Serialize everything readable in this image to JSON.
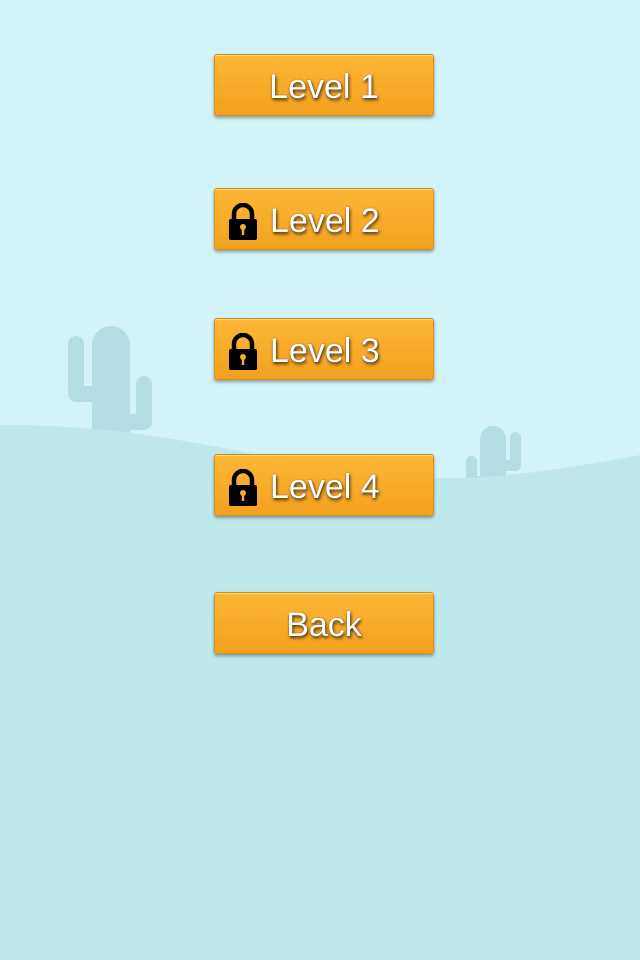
{
  "screen": "level-select",
  "background": {
    "sky_color": "#d2f3f7",
    "ground_color": "#bfe8ec",
    "cactus_color": "#b3dfe4"
  },
  "buttons": [
    {
      "label": "Level 1",
      "locked": false,
      "icon": null
    },
    {
      "label": "Level 2",
      "locked": true,
      "icon": "lock-icon"
    },
    {
      "label": "Level 3",
      "locked": true,
      "icon": "lock-icon"
    },
    {
      "label": "Level 4",
      "locked": true,
      "icon": "lock-icon"
    }
  ],
  "back_button": {
    "label": "Back"
  },
  "colors": {
    "button_fill": "#f9ad2c",
    "button_text": "#ffffff",
    "lock_icon": "#000000"
  }
}
